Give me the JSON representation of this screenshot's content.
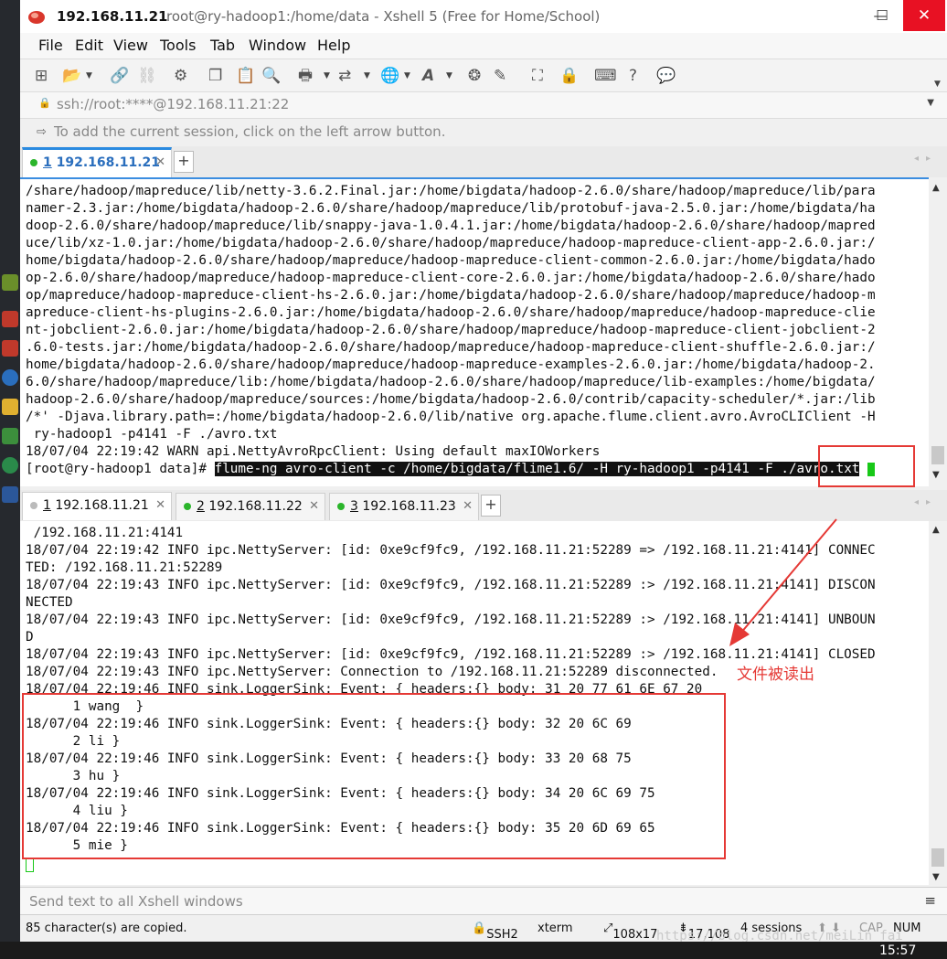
{
  "window": {
    "ip": "192.168.11.21",
    "title": "root@ry-hadoop1:/home/data - Xshell 5 (Free for Home/School)",
    "controls": {
      "minimize": "—",
      "maximize": "☐",
      "close": "✕"
    }
  },
  "menu": [
    "File",
    "Edit",
    "View",
    "Tools",
    "Tab",
    "Window",
    "Help"
  ],
  "address": {
    "url": "ssh://root:****@192.168.11.21:22",
    "hint": "To add the current session, click on the left arrow button."
  },
  "top_tab": {
    "num": "1",
    "label": "192.168.11.21"
  },
  "top_terminal": {
    "lines": [
      "/share/hadoop/mapreduce/lib/netty-3.6.2.Final.jar:/home/bigdata/hadoop-2.6.0/share/hadoop/mapreduce/lib/para",
      "namer-2.3.jar:/home/bigdata/hadoop-2.6.0/share/hadoop/mapreduce/lib/protobuf-java-2.5.0.jar:/home/bigdata/ha",
      "doop-2.6.0/share/hadoop/mapreduce/lib/snappy-java-1.0.4.1.jar:/home/bigdata/hadoop-2.6.0/share/hadoop/mapred",
      "uce/lib/xz-1.0.jar:/home/bigdata/hadoop-2.6.0/share/hadoop/mapreduce/hadoop-mapreduce-client-app-2.6.0.jar:/",
      "home/bigdata/hadoop-2.6.0/share/hadoop/mapreduce/hadoop-mapreduce-client-common-2.6.0.jar:/home/bigdata/hado",
      "op-2.6.0/share/hadoop/mapreduce/hadoop-mapreduce-client-core-2.6.0.jar:/home/bigdata/hadoop-2.6.0/share/hado",
      "op/mapreduce/hadoop-mapreduce-client-hs-2.6.0.jar:/home/bigdata/hadoop-2.6.0/share/hadoop/mapreduce/hadoop-m",
      "apreduce-client-hs-plugins-2.6.0.jar:/home/bigdata/hadoop-2.6.0/share/hadoop/mapreduce/hadoop-mapreduce-clie",
      "nt-jobclient-2.6.0.jar:/home/bigdata/hadoop-2.6.0/share/hadoop/mapreduce/hadoop-mapreduce-client-jobclient-2",
      ".6.0-tests.jar:/home/bigdata/hadoop-2.6.0/share/hadoop/mapreduce/hadoop-mapreduce-client-shuffle-2.6.0.jar:/",
      "home/bigdata/hadoop-2.6.0/share/hadoop/mapreduce/hadoop-mapreduce-examples-2.6.0.jar:/home/bigdata/hadoop-2.",
      "6.0/share/hadoop/mapreduce/lib:/home/bigdata/hadoop-2.6.0/share/hadoop/mapreduce/lib-examples:/home/bigdata/",
      "hadoop-2.6.0/share/hadoop/mapreduce/sources:/home/bigdata/hadoop-2.6.0/contrib/capacity-scheduler/*.jar:/lib",
      "/*' -Djava.library.path=:/home/bigdata/hadoop-2.6.0/lib/native org.apache.flume.client.avro.AvroCLIClient -H",
      " ry-hadoop1 -p4141 -F ./avro.txt",
      "18/07/04 22:19:42 WARN api.NettyAvroRpcClient: Using default maxIOWorkers"
    ],
    "prompt": "[root@ry-hadoop1 data]# ",
    "command": "flume-ng avro-client -c /home/bigdata/flime1.6/ -H ry-hadoop1 -p4141 -F ./avro.txt"
  },
  "bottom_tabs": [
    {
      "num": "1",
      "label": "192.168.11.21"
    },
    {
      "num": "2",
      "label": "192.168.11.22"
    },
    {
      "num": "3",
      "label": "192.168.11.23"
    }
  ],
  "bottom_terminal": {
    "lines": [
      " /192.168.11.21:4141",
      "18/07/04 22:19:42 INFO ipc.NettyServer: [id: 0xe9cf9fc9, /192.168.11.21:52289 => /192.168.11.21:4141] CONNEC",
      "TED: /192.168.11.21:52289",
      "18/07/04 22:19:43 INFO ipc.NettyServer: [id: 0xe9cf9fc9, /192.168.11.21:52289 :> /192.168.11.21:4141] DISCON",
      "NECTED",
      "18/07/04 22:19:43 INFO ipc.NettyServer: [id: 0xe9cf9fc9, /192.168.11.21:52289 :> /192.168.11.21:4141] UNBOUN",
      "D",
      "18/07/04 22:19:43 INFO ipc.NettyServer: [id: 0xe9cf9fc9, /192.168.11.21:52289 :> /192.168.11.21:4141] CLOSED",
      "18/07/04 22:19:43 INFO ipc.NettyServer: Connection to /192.168.11.21:52289 disconnected.",
      "18/07/04 22:19:46 INFO sink.LoggerSink: Event: { headers:{} body: 31 20 77 61 6E 67 20",
      "      1 wang  }",
      "18/07/04 22:19:46 INFO sink.LoggerSink: Event: { headers:{} body: 32 20 6C 69",
      "      2 li }",
      "18/07/04 22:19:46 INFO sink.LoggerSink: Event: { headers:{} body: 33 20 68 75",
      "      3 hu }",
      "18/07/04 22:19:46 INFO sink.LoggerSink: Event: { headers:{} body: 34 20 6C 69 75",
      "      4 liu }",
      "18/07/04 22:19:46 INFO sink.LoggerSink: Event: { headers:{} body: 35 20 6D 69 65",
      "      5 mie }"
    ]
  },
  "annotation": "文件被读出",
  "send_bar": {
    "text": "Send text to all Xshell windows",
    "menu": "≡"
  },
  "status": {
    "copied": "85 character(s) are copied.",
    "protocol": "SSH2",
    "term": "xterm",
    "size": "108x17",
    "pos": "17,108",
    "sessions": "4 sessions",
    "cap": "CAP",
    "num": "NUM"
  },
  "watermark": "https://blog.csdn.net/meiLin_fai",
  "clock": "15:57",
  "colors": {
    "accent": "#2a8ae0",
    "annotation": "#e53935",
    "cursor": "#18c818",
    "close": "#e81123"
  }
}
